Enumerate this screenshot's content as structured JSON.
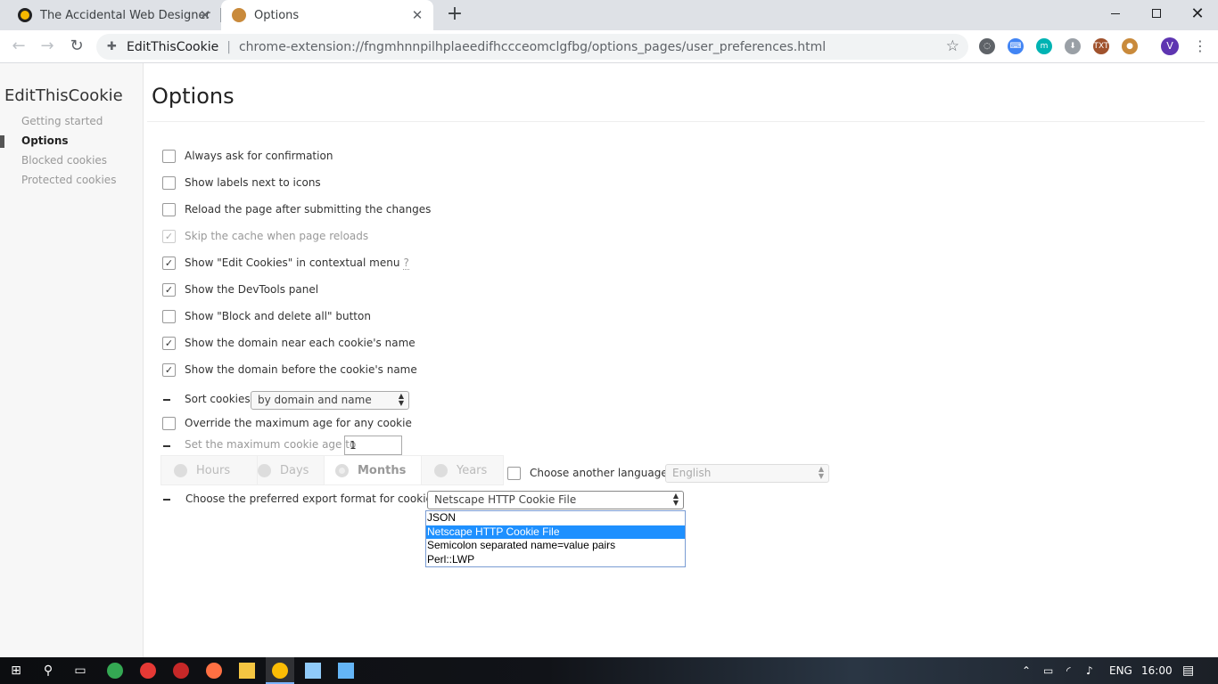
{
  "browser": {
    "tabs": [
      {
        "title": "The Accidental Web Designer"
      },
      {
        "title": "Options"
      }
    ],
    "tab_close": "✕",
    "new_tab": "+",
    "window_controls": {
      "close": "✕"
    },
    "nav": {
      "back": "←",
      "forward": "→",
      "reload": "↻"
    },
    "omnibox": {
      "origin": "EditThisCookie",
      "separator": "|",
      "url": "chrome-extension://fngmhnnpilhplaeedifhccceomclgfbg/options_pages/user_preferences.html",
      "star": "☆"
    },
    "extensions": [
      {
        "icon": "circle-ext-icon",
        "glyph": "◌",
        "color": "#5f6368"
      },
      {
        "icon": "keyboard-ext-icon",
        "glyph": "⌨",
        "color": "#4285f4"
      },
      {
        "icon": "mercury-ext-icon",
        "glyph": "m",
        "color": "#00b3b3"
      },
      {
        "icon": "download-ext-icon",
        "glyph": "⬇",
        "color": "#9aa0a6"
      },
      {
        "icon": "txt-ext-icon",
        "glyph": "TXT",
        "color": "#a0522d"
      },
      {
        "icon": "cookie-ext-icon",
        "glyph": "●",
        "color": "#c98a3b"
      }
    ],
    "avatar_letter": "V",
    "menu": "⋮"
  },
  "sidebar": {
    "title": "EditThisCookie",
    "items": [
      {
        "label": "Getting started",
        "active": false
      },
      {
        "label": "Options",
        "active": true
      },
      {
        "label": "Blocked cookies",
        "active": false
      },
      {
        "label": "Protected cookies",
        "active": false
      }
    ]
  },
  "main": {
    "title": "Options",
    "options": [
      {
        "label": "Always ask for confirmation",
        "checked": false,
        "disabled": false
      },
      {
        "label": "Show labels next to icons",
        "checked": false,
        "disabled": false
      },
      {
        "label": "Reload the page after submitting the changes",
        "checked": false,
        "disabled": false
      },
      {
        "label": "Skip the cache when page reloads",
        "checked": true,
        "disabled": true
      },
      {
        "label": "Show \"Edit Cookies\" in contextual menu",
        "checked": true,
        "disabled": false,
        "help": "?"
      },
      {
        "label": "Show the DevTools panel",
        "checked": true,
        "disabled": false
      },
      {
        "label": "Show \"Block and delete all\" button",
        "checked": false,
        "disabled": false
      },
      {
        "label": "Show the domain near each cookie's name",
        "checked": true,
        "disabled": false
      },
      {
        "label": "Show the domain before the cookie's name",
        "checked": true,
        "disabled": false
      }
    ],
    "sort": {
      "label": "Sort cookies",
      "value": "by domain and name"
    },
    "override_age": {
      "label": "Override the maximum age for any cookie",
      "checked": false
    },
    "max_age": {
      "label": "Set the maximum cookie age to",
      "value": "1"
    },
    "age_units": {
      "options": [
        "Hours",
        "Days",
        "Months",
        "Years"
      ],
      "selected": "Months"
    },
    "language": {
      "label": "Choose another language:",
      "checked": false,
      "value": "English"
    },
    "export": {
      "label": "Choose the preferred export format for cookies",
      "value": "Netscape HTTP Cookie File",
      "options": [
        "JSON",
        "Netscape HTTP Cookie File",
        "Semicolon separated name=value pairs",
        "Perl::LWP"
      ],
      "highlighted": "Netscape HTTP Cookie File"
    }
  },
  "taskbar": {
    "language": "ENG",
    "time": "16:00"
  }
}
